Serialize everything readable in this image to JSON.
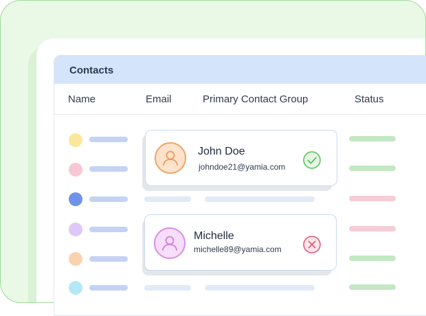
{
  "table": {
    "title": "Contacts",
    "columns": [
      "Name",
      "Email",
      "Primary Contact Group",
      "Status"
    ]
  },
  "cards": [
    {
      "name": "John Doe",
      "email": "johndoe21@yamia.com",
      "status_icon": "check-circle-icon"
    },
    {
      "name": "Michelle",
      "email": "michelle89@yamia.com",
      "status_icon": "x-circle-icon"
    }
  ],
  "colors": {
    "accent_green": "#5bc25d",
    "accent_red": "#e55b7a",
    "header_blue": "#d3e4fb",
    "dot_colors": [
      "#fbe79a",
      "#f7c7d6",
      "#6f93e8",
      "#ddc9f7",
      "#fbd2b0",
      "#b3e8f8"
    ]
  }
}
